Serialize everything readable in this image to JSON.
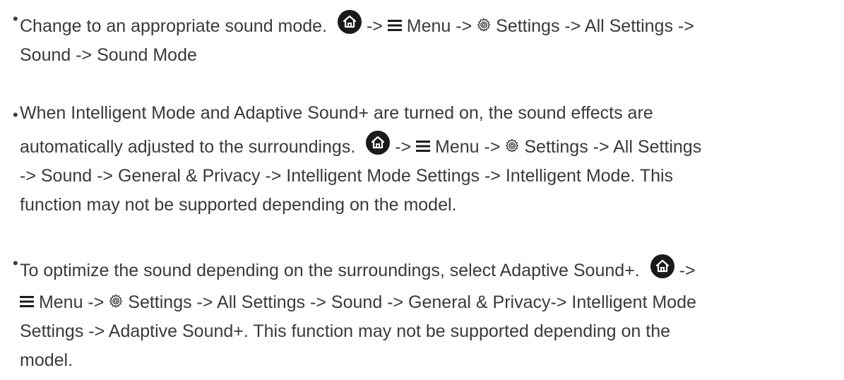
{
  "items": [
    {
      "lines": [
        [
          "Change to an appropriate sound mode.",
          "->",
          "Menu ->",
          "Settings -> All Settings ->"
        ],
        [
          "Sound -> Sound Mode"
        ]
      ]
    },
    {
      "lines": [
        [
          "When Intelligent Mode and Adaptive Sound+ are turned on, the sound effects are"
        ],
        [
          "automatically adjusted to the surroundings.",
          "->",
          "Menu ->",
          "Settings -> All Settings"
        ],
        [
          "-> Sound -> General & Privacy -> Intelligent Mode Settings -> Intelligent Mode. This"
        ],
        [
          "function may not be supported depending on the model."
        ]
      ]
    },
    {
      "lines": [
        [
          "To optimize the sound depending on the surroundings, select Adaptive Sound+.",
          "->"
        ],
        [
          "Menu ->",
          "Settings -> All Settings -> Sound -> General & Privacy-> Intelligent Mode"
        ],
        [
          "Settings -> Adaptive Sound+. This function may not be supported depending on the"
        ],
        [
          "model."
        ]
      ]
    }
  ],
  "icons": {
    "home": "home-icon",
    "menu": "hamburger-menu-icon",
    "settings": "gear-icon"
  },
  "colors": {
    "text": "#3a3a3a",
    "icon_fill": "#1a1a1a"
  }
}
